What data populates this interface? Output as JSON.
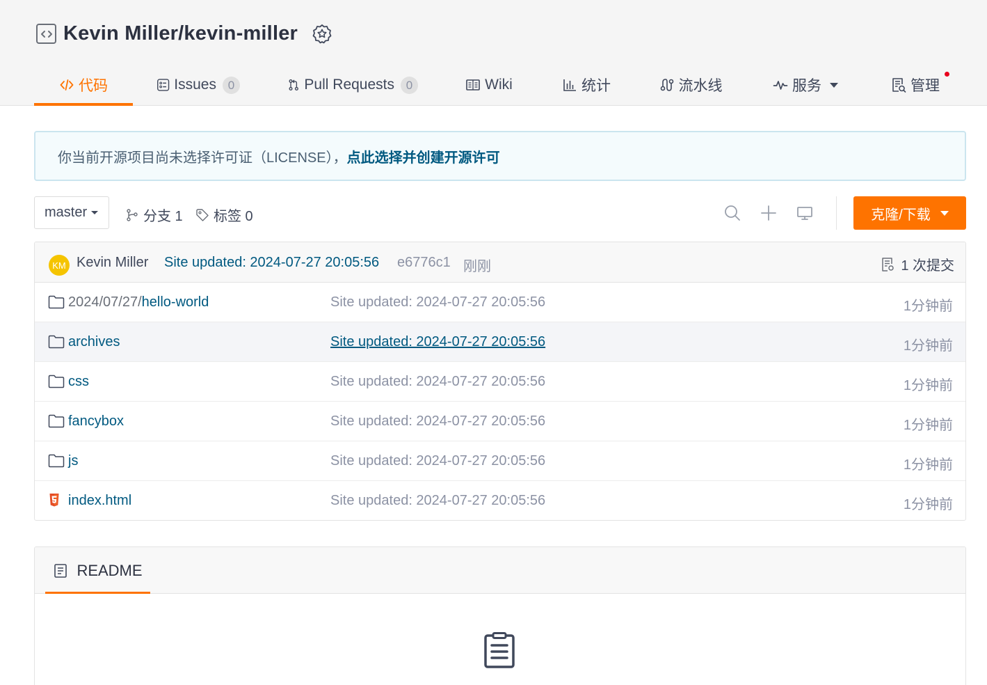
{
  "repo": {
    "title": "Kevin Miller/kevin-miller",
    "repo_icon": "code-repo-icon",
    "badge_icon": "award-badge-icon"
  },
  "tabs": [
    {
      "label": "代码",
      "icon": "code-icon",
      "active": true
    },
    {
      "label": "Issues",
      "icon": "issues-icon",
      "count": "0"
    },
    {
      "label": "Pull Requests",
      "icon": "pull-request-icon",
      "count": "0"
    },
    {
      "label": "Wiki",
      "icon": "wiki-book-icon"
    },
    {
      "label": "统计",
      "icon": "bar-chart-icon"
    },
    {
      "label": "流水线",
      "icon": "pipeline-icon"
    },
    {
      "label": "服务",
      "icon": "pulse-icon",
      "dropdown": true
    },
    {
      "label": "管理",
      "icon": "manage-doc-icon",
      "notification_dot": true
    }
  ],
  "license_notice": {
    "text": "你当前开源项目尚未选择许可证（LICENSE），",
    "link": "点此选择并创建开源许可"
  },
  "toolbar": {
    "branch": "master",
    "branches_label": "分支 1",
    "tags_label": "标签 0",
    "clone_label": "克隆/下载"
  },
  "last_commit": {
    "avatar_initials": "KM",
    "author": "Kevin Miller",
    "message": "Site updated: 2024-07-27 20:05:56",
    "hash": "e6776c1",
    "time": "刚刚",
    "commit_count": "1 次提交"
  },
  "files": [
    {
      "prefix": "2024/07/27/",
      "name": "hello-world",
      "type": "folder",
      "message": "Site updated: 2024-07-27 20:05:56",
      "time": "1分钟前"
    },
    {
      "prefix": "",
      "name": "archives",
      "type": "folder",
      "message": "Site updated: 2024-07-27 20:05:56",
      "time": "1分钟前"
    },
    {
      "prefix": "",
      "name": "css",
      "type": "folder",
      "message": "Site updated: 2024-07-27 20:05:56",
      "time": "1分钟前"
    },
    {
      "prefix": "",
      "name": "fancybox",
      "type": "folder",
      "message": "Site updated: 2024-07-27 20:05:56",
      "time": "1分钟前"
    },
    {
      "prefix": "",
      "name": "js",
      "type": "folder",
      "message": "Site updated: 2024-07-27 20:05:56",
      "time": "1分钟前"
    },
    {
      "prefix": "",
      "name": "index.html",
      "type": "html5-file",
      "message": "Site updated: 2024-07-27 20:05:56",
      "time": "1分钟前"
    }
  ],
  "readme": {
    "tab_label": "README"
  },
  "colors": {
    "accent": "#fe7300",
    "link": "#005980",
    "muted": "#8c92a4",
    "avatar": "#f5c400",
    "notice_bg": "#f4fbfd"
  }
}
